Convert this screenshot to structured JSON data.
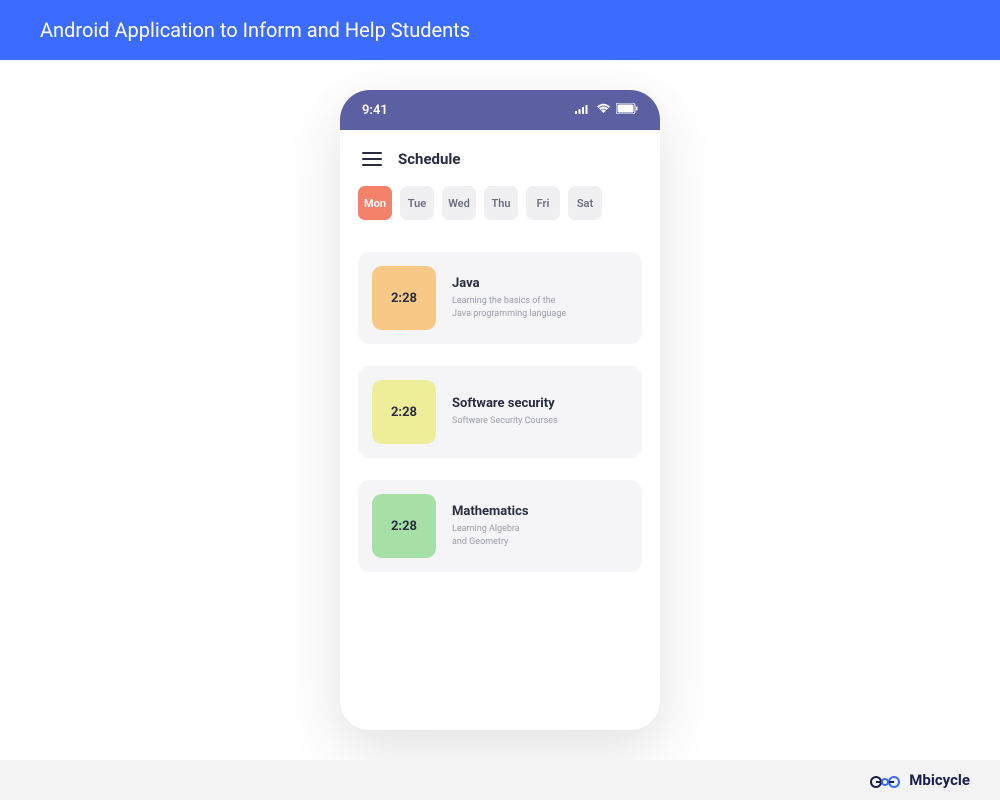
{
  "header": {
    "title": "Android Application to Inform and Help Students"
  },
  "statusBar": {
    "time": "9:41"
  },
  "app": {
    "title": "Schedule"
  },
  "days": [
    {
      "label": "Mon",
      "active": true
    },
    {
      "label": "Tue",
      "active": false
    },
    {
      "label": "Wed",
      "active": false
    },
    {
      "label": "Thu",
      "active": false
    },
    {
      "label": "Fri",
      "active": false
    },
    {
      "label": "Sat",
      "active": false
    }
  ],
  "courses": [
    {
      "time": "2:28",
      "title": "Java",
      "description": "Learning the basics of the\nJava programming language",
      "color": "#f7c886"
    },
    {
      "time": "2:28",
      "title": "Software security",
      "description": "Software Security Courses",
      "color": "#eeee9a"
    },
    {
      "time": "2:28",
      "title": "Mathematics",
      "description": "Learning Algebra\nand Geometry",
      "color": "#a6e0a6"
    }
  ],
  "footer": {
    "brand": "Mbicycle"
  }
}
